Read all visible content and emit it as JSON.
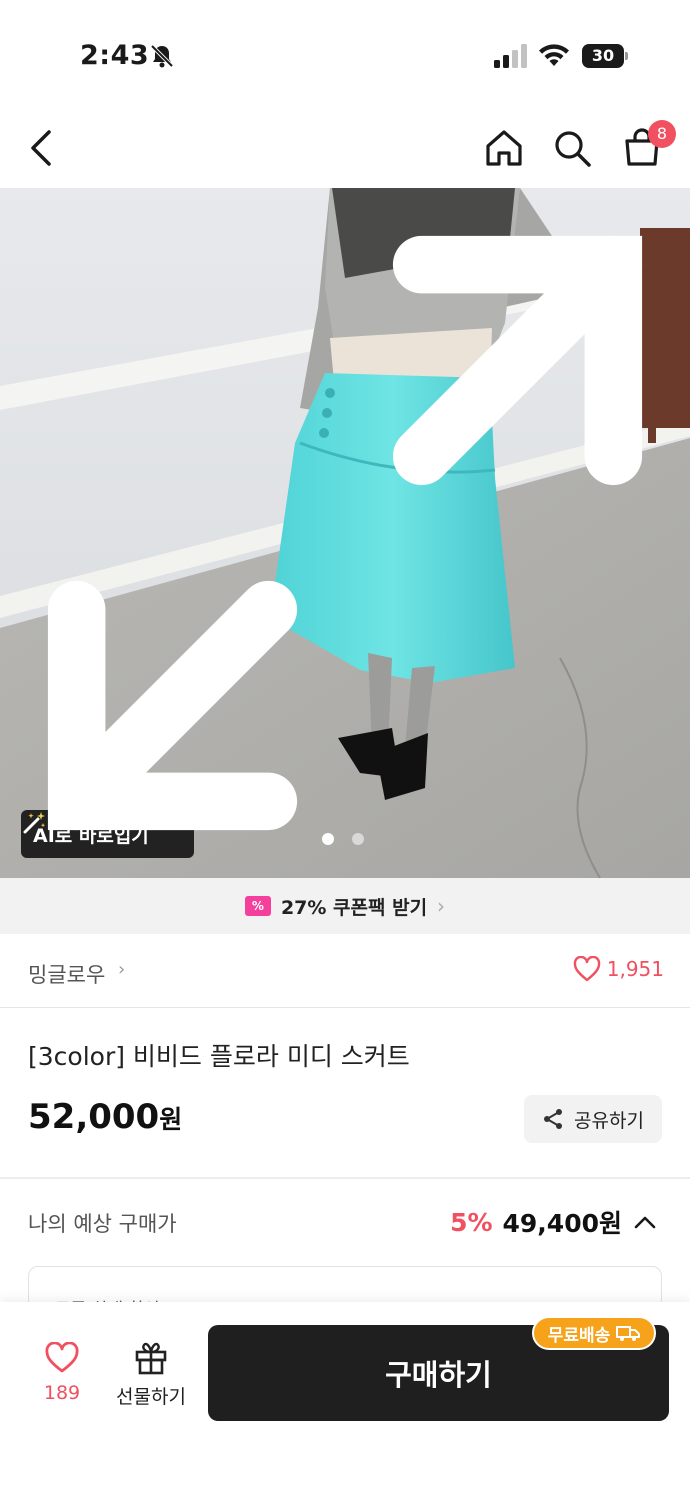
{
  "status_bar": {
    "time": "2:43",
    "battery": "30"
  },
  "nav": {
    "cart_count": "8"
  },
  "hero": {
    "ai_button_label": "AI로 바로입기",
    "slide_count": 2,
    "active_slide": 1
  },
  "coupon": {
    "icon_text": "%",
    "label": "27% 쿠폰팩 받기",
    "chevron": "›"
  },
  "brand": {
    "name": "밍글로우",
    "chevron": "›",
    "likes": "1,951"
  },
  "product": {
    "title": "[3color] 비비드 플로라 미디 스커트",
    "price": "52,000",
    "price_unit": "원",
    "share_label": "공유하기"
  },
  "estimate": {
    "label": "나의 예상 구매가",
    "discount": "5%",
    "price": "49,400원",
    "card_text": "쿠폰 최대 할인"
  },
  "bottom_bar": {
    "wish_count": "189",
    "gift_label": "선물하기",
    "buy_label": "구매하기",
    "free_shipping_label": "무료배송"
  },
  "colors": {
    "accent": "#f0505f",
    "coupon": "#f43f9c",
    "shipping_badge": "#f7a21b",
    "buy_button": "#1f1f1f"
  }
}
